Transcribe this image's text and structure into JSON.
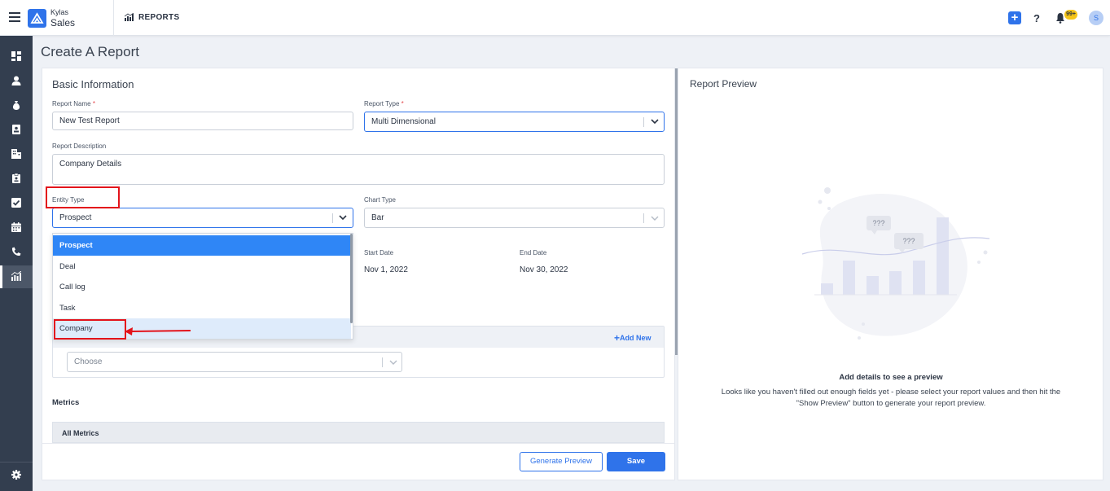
{
  "app": {
    "brand_small": "Kylas",
    "brand_main": "Sales",
    "module_title": "REPORTS"
  },
  "header": {
    "add_icon": "plus-icon",
    "help_label": "?",
    "notification_badge": "99+",
    "avatar_initial": "S"
  },
  "sidebar": {
    "items": [
      {
        "name": "dashboard",
        "icon": "dashboard-icon"
      },
      {
        "name": "contacts",
        "icon": "user-icon"
      },
      {
        "name": "deals",
        "icon": "money-bag-icon"
      },
      {
        "name": "leads",
        "icon": "id-card-icon"
      },
      {
        "name": "companies",
        "icon": "building-icon"
      },
      {
        "name": "documents",
        "icon": "clipboard-icon"
      },
      {
        "name": "tasks",
        "icon": "checkbox-icon"
      },
      {
        "name": "calendar",
        "icon": "calendar-icon"
      },
      {
        "name": "calls",
        "icon": "phone-icon"
      },
      {
        "name": "reports",
        "icon": "report-chart-icon",
        "active": true
      }
    ],
    "settings_icon": "gear-icon"
  },
  "page": {
    "title": "Create A Report"
  },
  "form": {
    "section_title": "Basic Information",
    "report_name": {
      "label": "Report Name",
      "required_mark": "*",
      "value": "New Test Report"
    },
    "report_type": {
      "label": "Report Type",
      "required_mark": "*",
      "value": "Multi Dimensional"
    },
    "report_description": {
      "label": "Report Description",
      "value": "Company Details"
    },
    "entity_type": {
      "label": "Entity Type",
      "value": "Prospect"
    },
    "chart_type": {
      "label": "Chart Type",
      "value": "Bar"
    },
    "start_date": {
      "label": "Start Date",
      "value": "Nov 1, 2022"
    },
    "end_date": {
      "label": "End Date",
      "value": "Nov 30, 2022"
    },
    "group_by": {
      "add_new_label": "Add New",
      "placeholder": "Choose"
    },
    "metrics_title": "Metrics",
    "all_metrics_label": "All Metrics"
  },
  "entity_dropdown": {
    "options": [
      "Prospect",
      "Deal",
      "Call log",
      "Task",
      "Company"
    ],
    "selected": "Prospect",
    "hovered": "Company"
  },
  "footer": {
    "generate_preview_label": "Generate Preview",
    "save_label": "Save"
  },
  "preview": {
    "title": "Report Preview",
    "heading": "Add details to see a preview",
    "message_line1": "Looks like you haven't filled out enough fields yet - please select your report values and then hit the",
    "message_line2": "\"Show Preview\" button to generate your report preview.",
    "illustration_marks": [
      "???",
      "???"
    ]
  },
  "colors": {
    "accent": "#2f73ea",
    "sidebar": "#333e4f",
    "annotation": "#e3131b",
    "selected_option": "#2f86f6"
  }
}
